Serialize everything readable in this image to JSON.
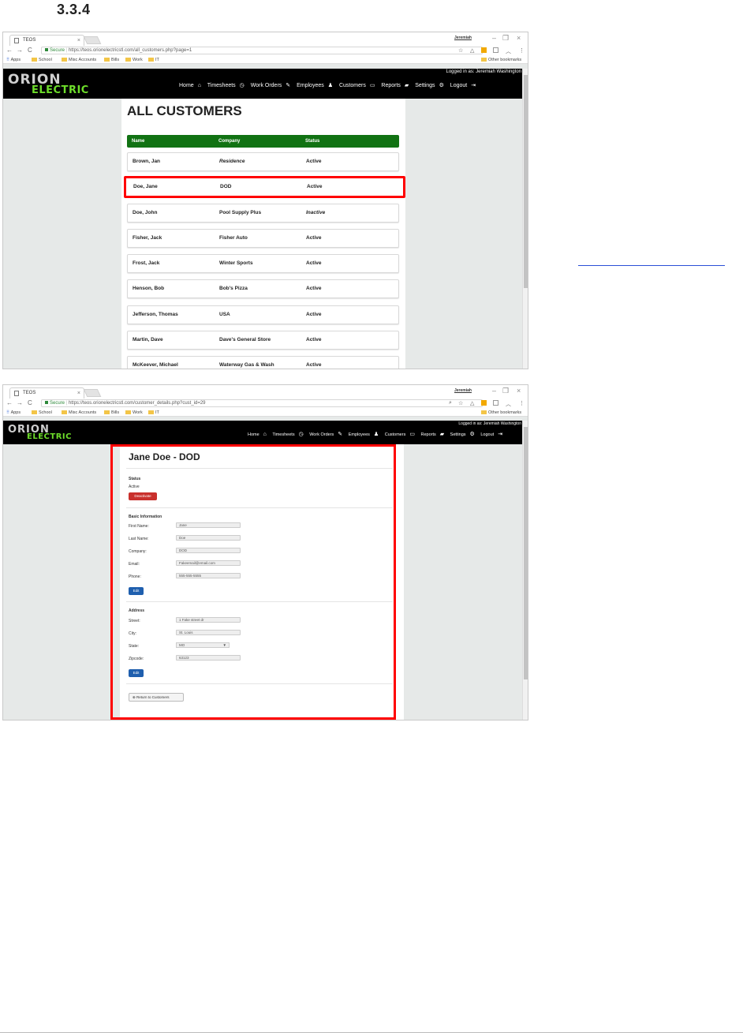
{
  "section_number": "3.3.4",
  "browser": {
    "tab_title": "TEOS",
    "profile_name": "Jeremiah",
    "url_secure_label": "Secure",
    "bookmarks": [
      "Apps",
      "School",
      "Misc Accounts",
      "Bills",
      "Work",
      "IT"
    ],
    "other_bookmarks": "Other bookmarks"
  },
  "app": {
    "logo_top": "ORION",
    "logo_bottom": "ELECTRIC",
    "logged_in": "Logged in as: Jeremiah Washington",
    "nav": [
      "Home",
      "Timesheets",
      "Work Orders",
      "Employees",
      "Customers",
      "Reports",
      "Settings",
      "Logout"
    ]
  },
  "customers_view": {
    "url": "https://teos.orionelectricstl.com/all_customers.php?page=1",
    "title": "ALL CUSTOMERS",
    "columns": [
      "Name",
      "Company",
      "Status"
    ],
    "rows": [
      {
        "name": "Brown, Jan",
        "company": "Residence",
        "status": "Active"
      },
      {
        "name": "Doe, Jane",
        "company": "DOD",
        "status": "Active"
      },
      {
        "name": "Doe, John",
        "company": "Pool Supply Plus",
        "status": "Inactive"
      },
      {
        "name": "Fisher, Jack",
        "company": "Fisher Auto",
        "status": "Active"
      },
      {
        "name": "Frost, Jack",
        "company": "Winter Sports",
        "status": "Active"
      },
      {
        "name": "Henson, Bob",
        "company": "Bob's Pizza",
        "status": "Active"
      },
      {
        "name": "Jefferson, Thomas",
        "company": "USA",
        "status": "Active"
      },
      {
        "name": "Martin, Dave",
        "company": "Dave's General Store",
        "status": "Active"
      },
      {
        "name": "McKeever, Michael",
        "company": "Waterway Gas & Wash",
        "status": "Active"
      }
    ]
  },
  "details_view": {
    "url": "https://teos.orionelectricstl.com/customer_details.php?cust_id=29",
    "title": "Jane Doe - DOD",
    "status_heading": "Status",
    "status_value": "Active",
    "deactivate_label": "Deactivate",
    "basic_heading": "Basic Information",
    "fields": [
      {
        "label": "First Name:",
        "value": "Jane"
      },
      {
        "label": "Last Name:",
        "value": "Doe"
      },
      {
        "label": "Company:",
        "value": "DOD"
      },
      {
        "label": "Email:",
        "value": "Fakeemail@email.com"
      },
      {
        "label": "Phone:",
        "value": "555-555-5555"
      }
    ],
    "edit_label": "Edit",
    "address_heading": "Address",
    "street_label": "Street:",
    "street_value": "1 Fake street dr",
    "city_label": "City:",
    "city_value": "St. Louis",
    "state_label": "State:",
    "state_value": "MO",
    "zip_label": "Zipcode:",
    "zip_value": "63123",
    "return_label": "Return to Customers"
  }
}
